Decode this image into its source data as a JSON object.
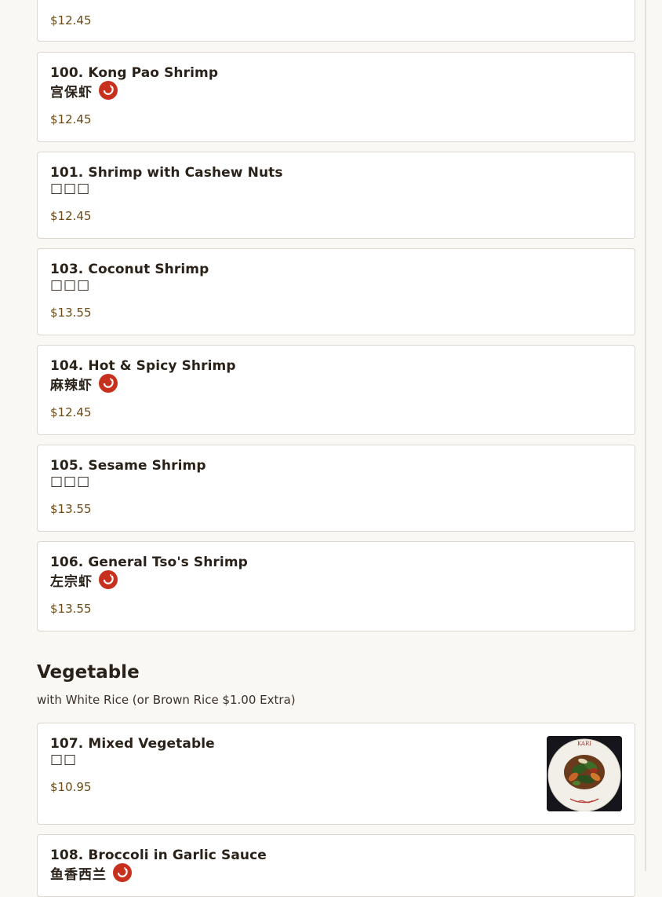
{
  "previous_item": {
    "price": "$12.45"
  },
  "shrimp_items": [
    {
      "name": "100. Kong Pao Shrimp",
      "chinese": "宫保虾",
      "spicy": true,
      "price": "$12.45"
    },
    {
      "name": "101. Shrimp with Cashew Nuts",
      "chinese": "□□□",
      "spicy": false,
      "price": "$12.45"
    },
    {
      "name": "103. Coconut Shrimp",
      "chinese": "□□□",
      "spicy": false,
      "price": "$13.55"
    },
    {
      "name": "104. Hot & Spicy Shrimp",
      "chinese": "麻辣虾",
      "spicy": true,
      "price": "$12.45"
    },
    {
      "name": "105. Sesame Shrimp",
      "chinese": "□□□",
      "spicy": false,
      "price": "$13.55"
    },
    {
      "name": "106. General Tso's Shrimp",
      "chinese": "左宗虾",
      "spicy": true,
      "price": "$13.55"
    }
  ],
  "vegetable_section": {
    "title": "Vegetable",
    "subtitle": "with White Rice (or Brown Rice $1.00 Extra)",
    "items": [
      {
        "name": "107. Mixed Vegetable",
        "chinese": "□□",
        "spicy": false,
        "price": "$10.95",
        "has_image": true,
        "image_text": "KARI"
      },
      {
        "name": "108. Broccoli in Garlic Sauce",
        "chinese": "鱼香西兰",
        "spicy": true
      }
    ]
  },
  "icons": {
    "spicy": "chili-pepper-icon",
    "dish_photo": "food-photo"
  },
  "colors": {
    "price": "#6b4a16",
    "spicy_badge": "#c8301e",
    "card_border": "#dcd8d0",
    "background": "#f9f8f5"
  }
}
